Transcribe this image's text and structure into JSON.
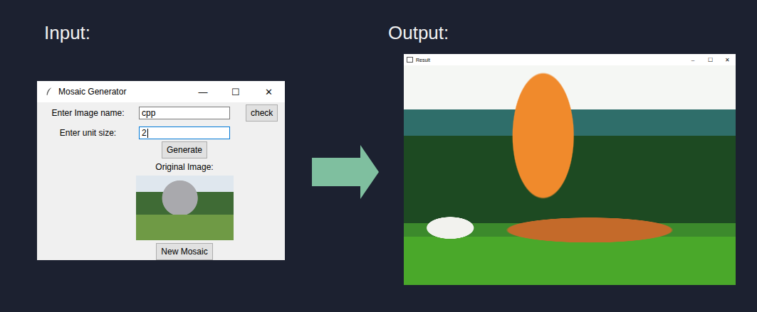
{
  "labels": {
    "input": "Input:",
    "output": "Output:"
  },
  "input_window": {
    "title": "Mosaic Generator",
    "controls": [
      "—",
      "☐",
      "✕"
    ],
    "fields": [
      {
        "label": "Enter Image name:",
        "value": "cpp",
        "focused": false
      },
      {
        "label": "Enter unit size:",
        "value": "2",
        "focused": true
      }
    ],
    "check_button": "check",
    "generate_button": "Generate",
    "original_label": "Original Image:",
    "new_button": "New Mosaic"
  },
  "output_window": {
    "title": "Result",
    "controls": [
      "–",
      "☐",
      "✕"
    ]
  }
}
